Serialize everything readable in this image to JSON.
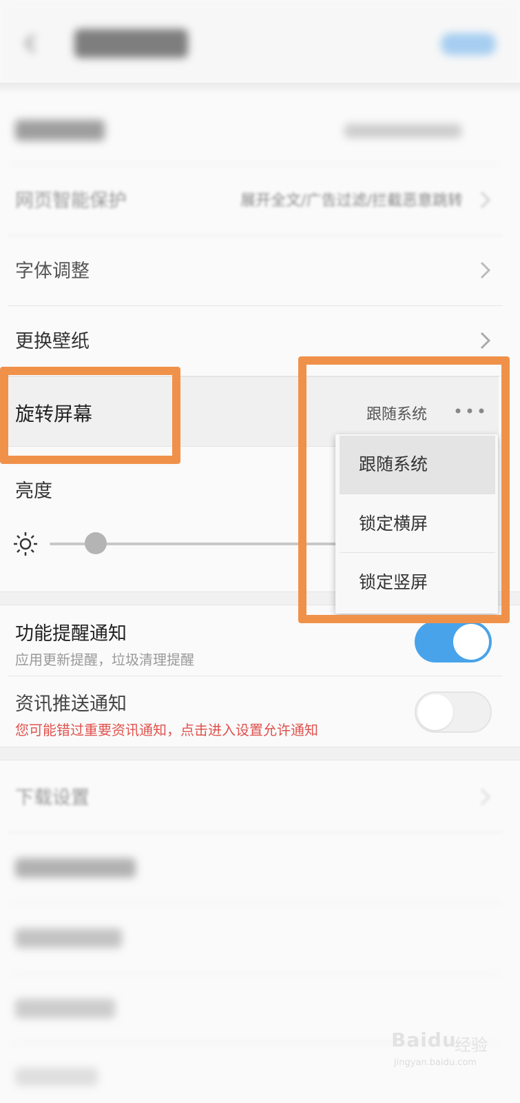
{
  "settings": {
    "web_protect": {
      "label": "网页智能保护",
      "value": "展开全文/广告过滤/拦截恶意跳转"
    },
    "font_adjust": {
      "label": "字体调整"
    },
    "wallpaper": {
      "label": "更换壁纸"
    },
    "rotate": {
      "label": "旋转屏幕",
      "current": "跟随系统"
    },
    "brightness": {
      "label": "亮度",
      "level": 0.16
    }
  },
  "dropdown": {
    "options": [
      "跟随系统",
      "锁定横屏",
      "锁定竖屏"
    ],
    "selected": "跟随系统"
  },
  "notifications": [
    {
      "title": "功能提醒通知",
      "subtitle": "应用更新提醒，垃圾清理提醒",
      "enabled": true
    },
    {
      "title": "资讯推送通知",
      "subtitle": "您可能错过重要资讯通知，点击进入设置允许通知",
      "enabled": false
    }
  ],
  "download": {
    "label": "下载设置"
  },
  "watermark": {
    "brand": "Baidu",
    "jingyan": "经验",
    "url": "jingyan.baidu.com"
  },
  "colors": {
    "accent": "#48a3ea",
    "highlight": "#f0914a",
    "warning": "#e0524d"
  }
}
